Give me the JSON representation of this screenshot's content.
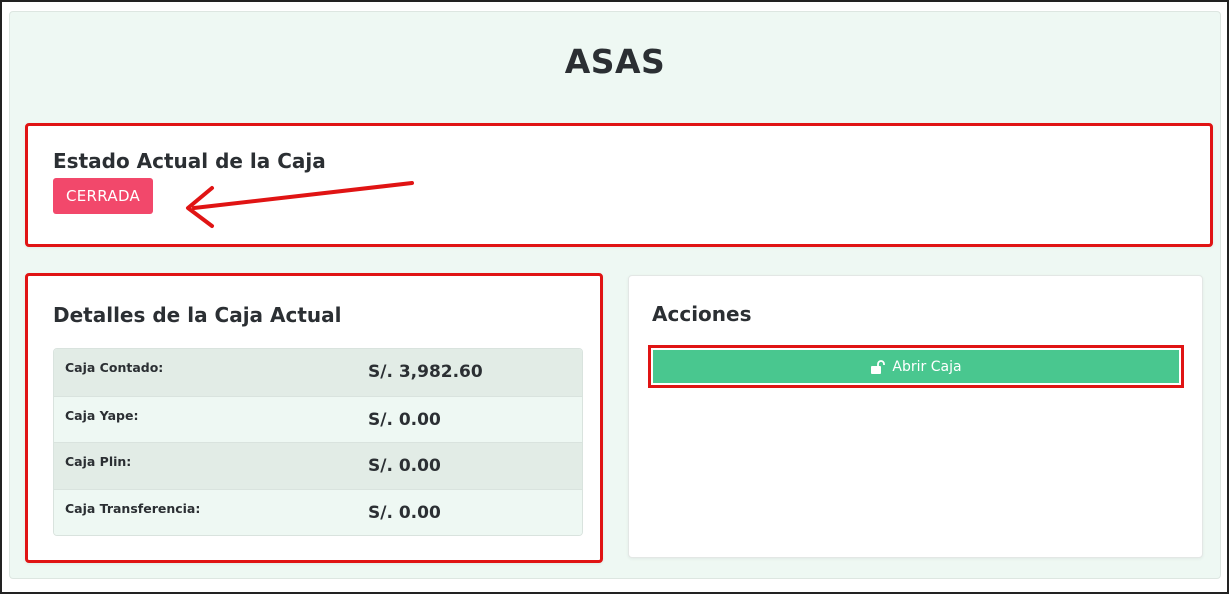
{
  "page": {
    "title": "ASAS"
  },
  "estado": {
    "title": "Estado Actual de la Caja",
    "badge": "CERRADA"
  },
  "detalles": {
    "title": "Detalles de la Caja Actual",
    "rows": [
      {
        "label": "Caja Contado:",
        "value": "S/. 3,982.60"
      },
      {
        "label": "Caja Yape:",
        "value": "S/. 0.00"
      },
      {
        "label": "Caja Plin:",
        "value": "S/. 0.00"
      },
      {
        "label": "Caja Transferencia:",
        "value": "S/. 0.00"
      }
    ]
  },
  "acciones": {
    "title": "Acciones",
    "open_button": {
      "label": "Abrir Caja",
      "icon": "unlock-icon"
    }
  },
  "colors": {
    "badge": "#f2486b",
    "button": "#49c78f",
    "highlight": "#e01414",
    "background": "#eef8f3"
  }
}
